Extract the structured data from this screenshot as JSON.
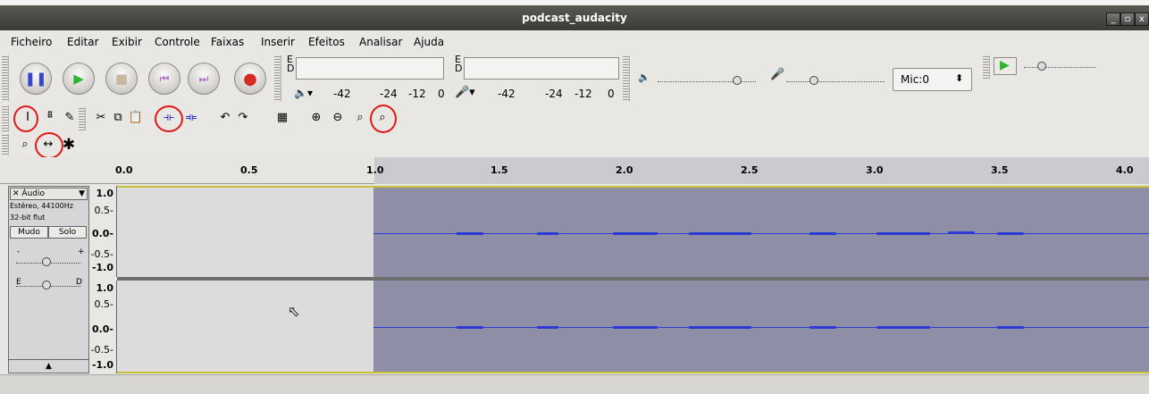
{
  "window": {
    "title": "podcast_audacity"
  },
  "menu": [
    "Ficheiro",
    "Editar",
    "Exibir",
    "Controle",
    "Faixas",
    "Inserir",
    "Efeitos",
    "Analisar",
    "Ajuda"
  ],
  "meters": {
    "left_ch_label": "E",
    "right_ch_label": "D",
    "scale": [
      "-42",
      "-24",
      "-12",
      "0"
    ]
  },
  "mixer": {
    "input_source": "Mic:0"
  },
  "ruler": {
    "ticks": [
      "0.0",
      "0.5",
      "1.0",
      "1.5",
      "2.0",
      "2.5",
      "3.0",
      "3.5",
      "4.0"
    ]
  },
  "track": {
    "name": "Áudio",
    "format": "Estéreo, 44100Hz",
    "bits": "32-bit flut",
    "mute_label": "Mudo",
    "solo_label": "Solo",
    "gain_minus": "-",
    "gain_plus": "+",
    "pan_left": "E",
    "pan_right": "D",
    "scale_top": [
      "1.0",
      "0.5-",
      "0.0-",
      "-0.5-",
      "-1.0"
    ],
    "scale_bottom": [
      "1.0",
      "0.5-",
      "0.0-",
      "-0.5-",
      "-1.0"
    ]
  },
  "icons": {
    "pause": "pause-icon",
    "play": "play-icon",
    "stop": "stop-icon",
    "skip_start": "skip-start-icon",
    "skip_end": "skip-end-icon",
    "record": "record-icon"
  },
  "colors": {
    "waveform": "#2c3bd5",
    "selection": "#8e8fa6",
    "unselected": "#dcdcdc",
    "annotation": "#e01818"
  }
}
